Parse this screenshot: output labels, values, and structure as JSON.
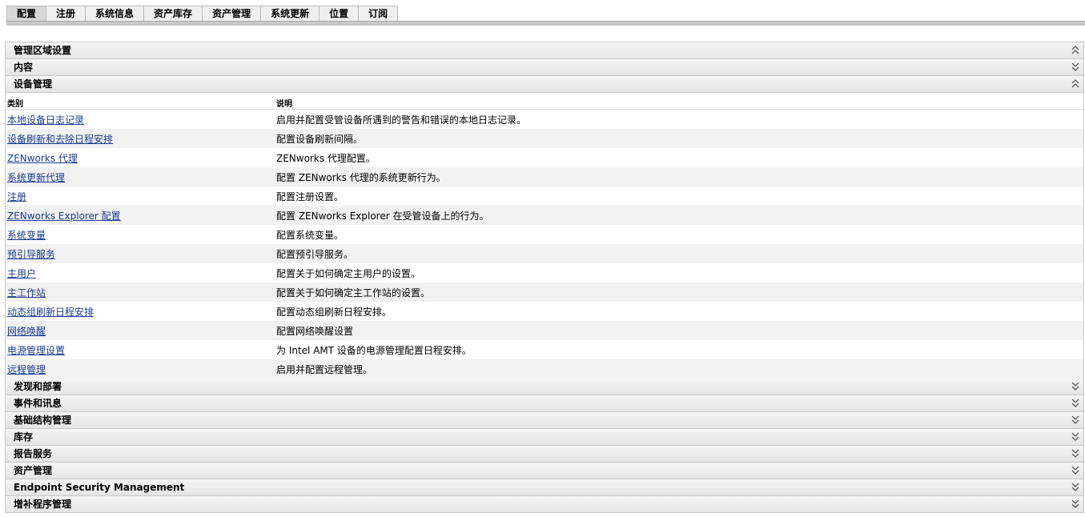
{
  "tabs": [
    {
      "label": "配置",
      "active": true
    },
    {
      "label": "注册",
      "active": false
    },
    {
      "label": "系统信息",
      "active": false
    },
    {
      "label": "资产库存",
      "active": false
    },
    {
      "label": "资产管理",
      "active": false
    },
    {
      "label": "系统更新",
      "active": false
    },
    {
      "label": "位置",
      "active": false
    },
    {
      "label": "订阅",
      "active": false
    }
  ],
  "panel": {
    "title": "管理区域设置",
    "title_icon": "collapse-up-icon",
    "sections_before": [
      {
        "title": "内容",
        "icon": "expand-down-icon"
      }
    ],
    "device_management": {
      "title": "设备管理",
      "icon": "collapse-up-icon",
      "col_category": "类别",
      "col_description": "说明",
      "rows": [
        {
          "name": "本地设备日志记录",
          "desc": "启用并配置受管设备所遇到的警告和错误的本地日志记录。"
        },
        {
          "name": "设备刷新和去除日程安排",
          "desc": "配置设备刷新间隔。"
        },
        {
          "name": "ZENworks 代理",
          "desc": "ZENworks 代理配置。"
        },
        {
          "name": "系统更新代理",
          "desc": "配置 ZENworks 代理的系统更新行为。"
        },
        {
          "name": "注册",
          "desc": "配置注册设置。"
        },
        {
          "name": "ZENworks Explorer 配置",
          "desc": "配置 ZENworks Explorer 在受管设备上的行为。"
        },
        {
          "name": "系统变量",
          "desc": "配置系统变量。"
        },
        {
          "name": "预引导服务",
          "desc": "配置预引导服务。"
        },
        {
          "name": "主用户",
          "desc": "配置关于如何确定主用户的设置。"
        },
        {
          "name": "主工作站",
          "desc": "配置关于如何确定主工作站的设置。"
        },
        {
          "name": "动态组刷新日程安排",
          "desc": "配置动态组刷新日程安排。"
        },
        {
          "name": "网络唤醒",
          "desc": "配置网络唤醒设置"
        },
        {
          "name": "电源管理设置",
          "desc": "为 Intel AMT 设备的电源管理配置日程安排。"
        },
        {
          "name": "远程管理",
          "desc": "启用并配置远程管理。"
        }
      ]
    },
    "sections_after": [
      {
        "title": "发现和部署",
        "icon": "expand-down-icon"
      },
      {
        "title": "事件和讯息",
        "icon": "expand-down-icon"
      },
      {
        "title": "基础结构管理",
        "icon": "expand-down-icon"
      },
      {
        "title": "库存",
        "icon": "expand-down-icon"
      },
      {
        "title": "报告服务",
        "icon": "expand-down-icon"
      },
      {
        "title": "资产管理",
        "icon": "expand-down-icon"
      },
      {
        "title": "Endpoint Security Management",
        "icon": "expand-down-icon"
      },
      {
        "title": "增补程序管理",
        "icon": "expand-down-icon"
      }
    ]
  },
  "colors": {
    "link": "#1a3d8f",
    "row_alt": "#f1f1f1",
    "header_bg": "#e9e9e9",
    "border": "#c8c8c8"
  }
}
